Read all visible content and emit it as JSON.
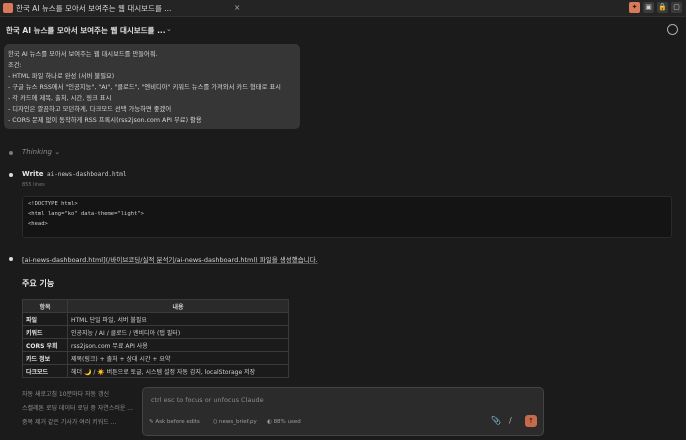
{
  "window": {
    "tab_title": "한국 AI 뉴스를 모아서 보여주는 웹 대시보드를 ...",
    "close_glyph": "×",
    "top_buttons": [
      "✦",
      "▣",
      "🔒",
      "▢"
    ]
  },
  "conversation": {
    "title": "한국 AI 뉴스를 모아서 보여주는 웹 대시보드를 ...",
    "dropdown_glyph": "⌄"
  },
  "user_message": {
    "lines": [
      "한국 AI 뉴스를 모아서 보여주는 웹 대시보드를 만들어줘.",
      "조건:",
      "- HTML 파일 하나로 완성 (서버 불필요)",
      "- 구글 뉴스 RSS에서 \"인공지능\", \"AI\", \"클로드\", \"엔비디아\" 키워드 뉴스를 가져와서 카드 형태로 표시",
      "- 각 카드에 제목, 출처, 시간, 링크 표시",
      "- 디자인은 깔끔하고 모던하게, 다크모드 선택 가능하면 좋겠어",
      "- CORS 문제 없이 동작하게 RSS 프록시(rss2json.com API 무료) 활용"
    ]
  },
  "thinking": {
    "label": "Thinking",
    "chevron": "⌄"
  },
  "write_tool": {
    "label": "Write",
    "filename": "ai-news-dashboard.html",
    "subtitle": "855 lines",
    "code_lines": [
      "<!DOCTYPE html>",
      "<html lang=\"ko\" data-theme=\"light\">",
      "<head>"
    ]
  },
  "response": {
    "text": "[ai-news-dashboard.html](/바이브코딩/실적 분석기/ai-news-dashboard.html) 파일을 생성했습니다.",
    "heading": "주요 기능",
    "table": {
      "headers": [
        "항목",
        "내용"
      ],
      "rows": [
        [
          "파일",
          "HTML 단일 파일, 서버 불필요"
        ],
        [
          "키워드",
          "인공지능 / AI / 클로드 / 엔비디아 (탭 필터)"
        ],
        [
          "CORS 우회",
          "rss2json.com 무료 API 사용"
        ],
        [
          "카드 정보",
          "제목(링크) + 출처 + 상대 시간 + 요약"
        ],
        [
          "다크모드",
          "헤더 🌙 / ☀️ 버튼으로 토글, 시스템 설정 자동 감지, localStorage 저장"
        ]
      ]
    },
    "extra_rows": [
      "자동 새로고침 10분마다 자동 갱신",
      "스켈레톤 로딩 데이터 로딩 중 자연스러운 ...",
      "중복 제거 같은 기사가 여러 키워드 ..."
    ]
  },
  "input": {
    "placeholder": "ctrl esc to focus or unfocus Claude",
    "mode": "Ask before edits",
    "file": "news_brief.py",
    "usage": "88% used",
    "attach_glyph": "📎",
    "slash_glyph": "/",
    "send_glyph": "↑"
  },
  "colors": {
    "background": "#1b1b1b",
    "accent": "#d9795a",
    "user_bubble": "#363636"
  }
}
